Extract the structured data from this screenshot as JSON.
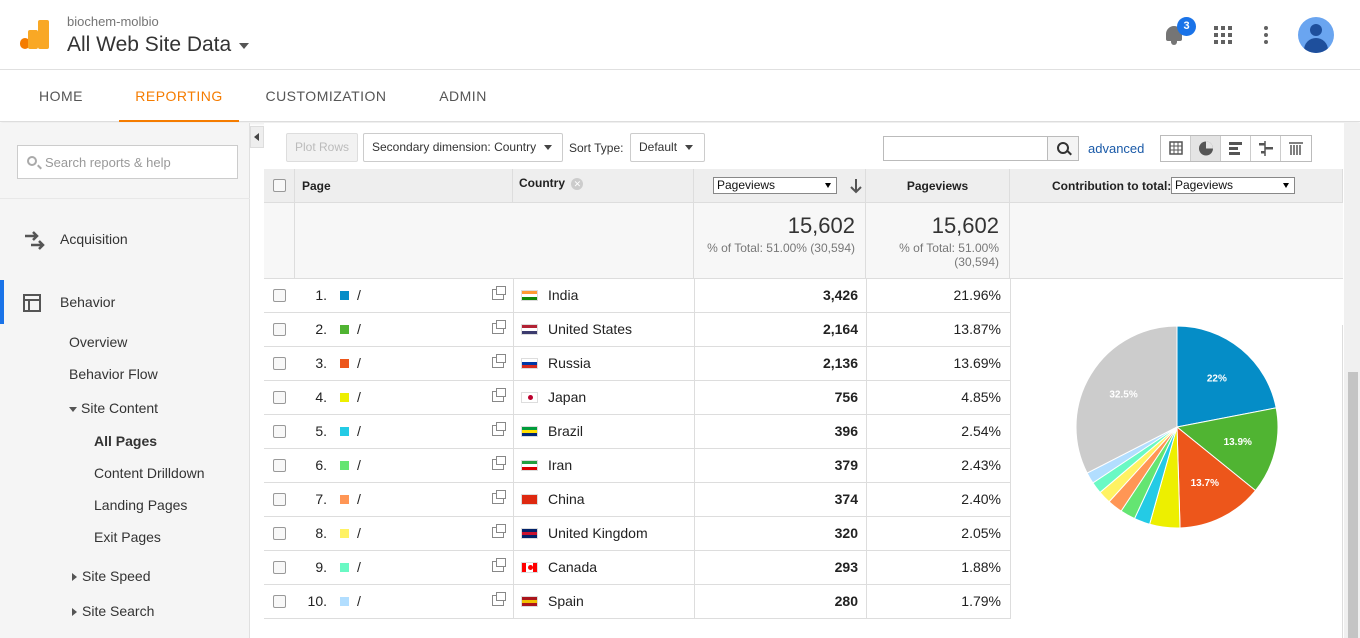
{
  "header": {
    "account": "biochem-molbio",
    "property": "All Web Site Data",
    "notifications": "3"
  },
  "nav": {
    "tabs": [
      {
        "label": "HOME"
      },
      {
        "label": "REPORTING"
      },
      {
        "label": "CUSTOMIZATION"
      },
      {
        "label": "ADMIN"
      }
    ]
  },
  "sidebar": {
    "search_placeholder": "Search reports & help",
    "acquisition": "Acquisition",
    "behavior": "Behavior",
    "overview": "Overview",
    "behavior_flow": "Behavior Flow",
    "site_content": "Site Content",
    "all_pages": "All Pages",
    "content_drilldown": "Content Drilldown",
    "landing_pages": "Landing Pages",
    "exit_pages": "Exit Pages",
    "site_speed": "Site Speed",
    "site_search": "Site Search"
  },
  "toolbar": {
    "plot_rows": "Plot Rows",
    "secondary_dimension": "Secondary dimension: Country",
    "sort_type_label": "Sort Type:",
    "sort_type_value": "Default",
    "advanced": "advanced"
  },
  "table": {
    "col_page": "Page",
    "col_country": "Country",
    "metric_select": "Pageviews",
    "col_pageviews": "Pageviews",
    "contribution_label": "Contribution to total:",
    "contribution_select": "Pageviews",
    "total_value": "15,602",
    "total_pct": "% of Total: 51.00% (30,594)",
    "total_pct_line1": "% of Total: 51.00%",
    "total_pct_line2": "(30,594)",
    "rows": [
      {
        "idx": "1.",
        "page": "/",
        "country": "India",
        "views": "3,426",
        "pct": "21.96%",
        "color": "#058dc7"
      },
      {
        "idx": "2.",
        "page": "/",
        "country": "United States",
        "views": "2,164",
        "pct": "13.87%",
        "color": "#50b432"
      },
      {
        "idx": "3.",
        "page": "/",
        "country": "Russia",
        "views": "2,136",
        "pct": "13.69%",
        "color": "#ed561b"
      },
      {
        "idx": "4.",
        "page": "/",
        "country": "Japan",
        "views": "756",
        "pct": "4.85%",
        "color": "#edef00"
      },
      {
        "idx": "5.",
        "page": "/",
        "country": "Brazil",
        "views": "396",
        "pct": "2.54%",
        "color": "#24cbe5"
      },
      {
        "idx": "6.",
        "page": "/",
        "country": "Iran",
        "views": "379",
        "pct": "2.43%",
        "color": "#64e572"
      },
      {
        "idx": "7.",
        "page": "/",
        "country": "China",
        "views": "374",
        "pct": "2.40%",
        "color": "#ff9655"
      },
      {
        "idx": "8.",
        "page": "/",
        "country": "United Kingdom",
        "views": "320",
        "pct": "2.05%",
        "color": "#fff263"
      },
      {
        "idx": "9.",
        "page": "/",
        "country": "Canada",
        "views": "293",
        "pct": "1.88%",
        "color": "#6af9c4"
      },
      {
        "idx": "10.",
        "page": "/",
        "country": "Spain",
        "views": "280",
        "pct": "1.79%",
        "color": "#b2deff"
      }
    ]
  },
  "chart_data": {
    "type": "pie",
    "slices": [
      {
        "value": 21.96,
        "color": "#058dc7",
        "label": "22%"
      },
      {
        "value": 13.87,
        "color": "#50b432",
        "label": "13.9%"
      },
      {
        "value": 13.69,
        "color": "#ed561b",
        "label": "13.7%"
      },
      {
        "value": 4.85,
        "color": "#edef00",
        "label": ""
      },
      {
        "value": 2.54,
        "color": "#24cbe5",
        "label": ""
      },
      {
        "value": 2.43,
        "color": "#64e572",
        "label": ""
      },
      {
        "value": 2.4,
        "color": "#ff9655",
        "label": ""
      },
      {
        "value": 2.05,
        "color": "#fff263",
        "label": ""
      },
      {
        "value": 1.88,
        "color": "#6af9c4",
        "label": ""
      },
      {
        "value": 1.79,
        "color": "#b2deff",
        "label": ""
      },
      {
        "value": 32.54,
        "color": "#cccccc",
        "label": "32.5%"
      }
    ]
  }
}
